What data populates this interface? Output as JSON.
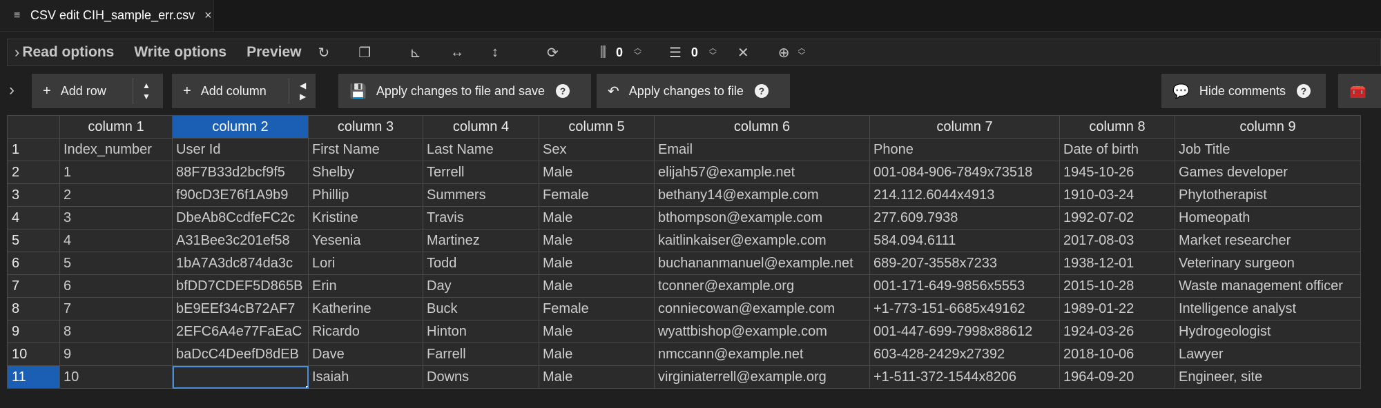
{
  "tab": {
    "title": "CSV edit CIH_sample_err.csv",
    "close": "×"
  },
  "options": {
    "read": "Read options",
    "write": "Write options",
    "preview": "Preview",
    "fixed_columns_value": "0",
    "fixed_rows_value": "0"
  },
  "buttons": {
    "add_row": "Add row",
    "add_column": "Add column",
    "apply_save": "Apply changes to file and save",
    "apply": "Apply changes to file",
    "hide_comments": "Hide comments",
    "help": "?"
  },
  "grid": {
    "column_headers": [
      "column 1",
      "column 2",
      "column 3",
      "column 4",
      "column 5",
      "column 6",
      "column 7",
      "column 8",
      "column 9"
    ],
    "row_numbers": [
      "1",
      "2",
      "3",
      "4",
      "5",
      "6",
      "7",
      "8",
      "9",
      "10",
      "11"
    ],
    "rows": [
      [
        "Index_number",
        "User Id",
        "First Name",
        "Last Name",
        "Sex",
        "Email",
        "Phone",
        "Date of birth",
        "Job Title"
      ],
      [
        "1",
        "88F7B33d2bcf9f5",
        "Shelby",
        "Terrell",
        "Male",
        "elijah57@example.net",
        "001-084-906-7849x73518",
        "1945-10-26",
        "Games developer"
      ],
      [
        "2",
        "f90cD3E76f1A9b9",
        "Phillip",
        "Summers",
        "Female",
        "bethany14@example.com",
        "214.112.6044x4913",
        "1910-03-24",
        "Phytotherapist"
      ],
      [
        "3",
        "DbeAb8CcdfeFC2c",
        "Kristine",
        "Travis",
        "Male",
        "bthompson@example.com",
        "277.609.7938",
        "1992-07-02",
        "Homeopath"
      ],
      [
        "4",
        "A31Bee3c201ef58",
        "Yesenia",
        "Martinez",
        "Male",
        "kaitlinkaiser@example.com",
        "584.094.6111",
        "2017-08-03",
        "Market researcher"
      ],
      [
        "5",
        "1bA7A3dc874da3c",
        "Lori",
        "Todd",
        "Male",
        "buchananmanuel@example.net",
        "689-207-3558x7233",
        "1938-12-01",
        "Veterinary surgeon"
      ],
      [
        "6",
        "bfDD7CDEF5D865B",
        "Erin",
        "Day",
        "Male",
        "tconner@example.org",
        "001-171-649-9856x5553",
        "2015-10-28",
        "Waste management officer"
      ],
      [
        "7",
        "bE9EEf34cB72AF7",
        "Katherine",
        "Buck",
        "Female",
        "conniecowan@example.com",
        "+1-773-151-6685x49162",
        "1989-01-22",
        "Intelligence analyst"
      ],
      [
        "8",
        "2EFC6A4e77FaEaC",
        "Ricardo",
        "Hinton",
        "Male",
        "wyattbishop@example.com",
        "001-447-699-7998x88612",
        "1924-03-26",
        "Hydrogeologist"
      ],
      [
        "9",
        "baDcC4DeefD8dEB",
        "Dave",
        "Farrell",
        "Male",
        "nmccann@example.net",
        "603-428-2429x27392",
        "2018-10-06",
        "Lawyer"
      ],
      [
        "10",
        "",
        "Isaiah",
        "Downs",
        "Male",
        "virginiaterrell@example.org",
        "+1-511-372-1544x8206",
        "1964-09-20",
        "Engineer, site"
      ]
    ]
  },
  "colors": {
    "selected": "#1a5fb4",
    "background": "#1f1f1f"
  }
}
